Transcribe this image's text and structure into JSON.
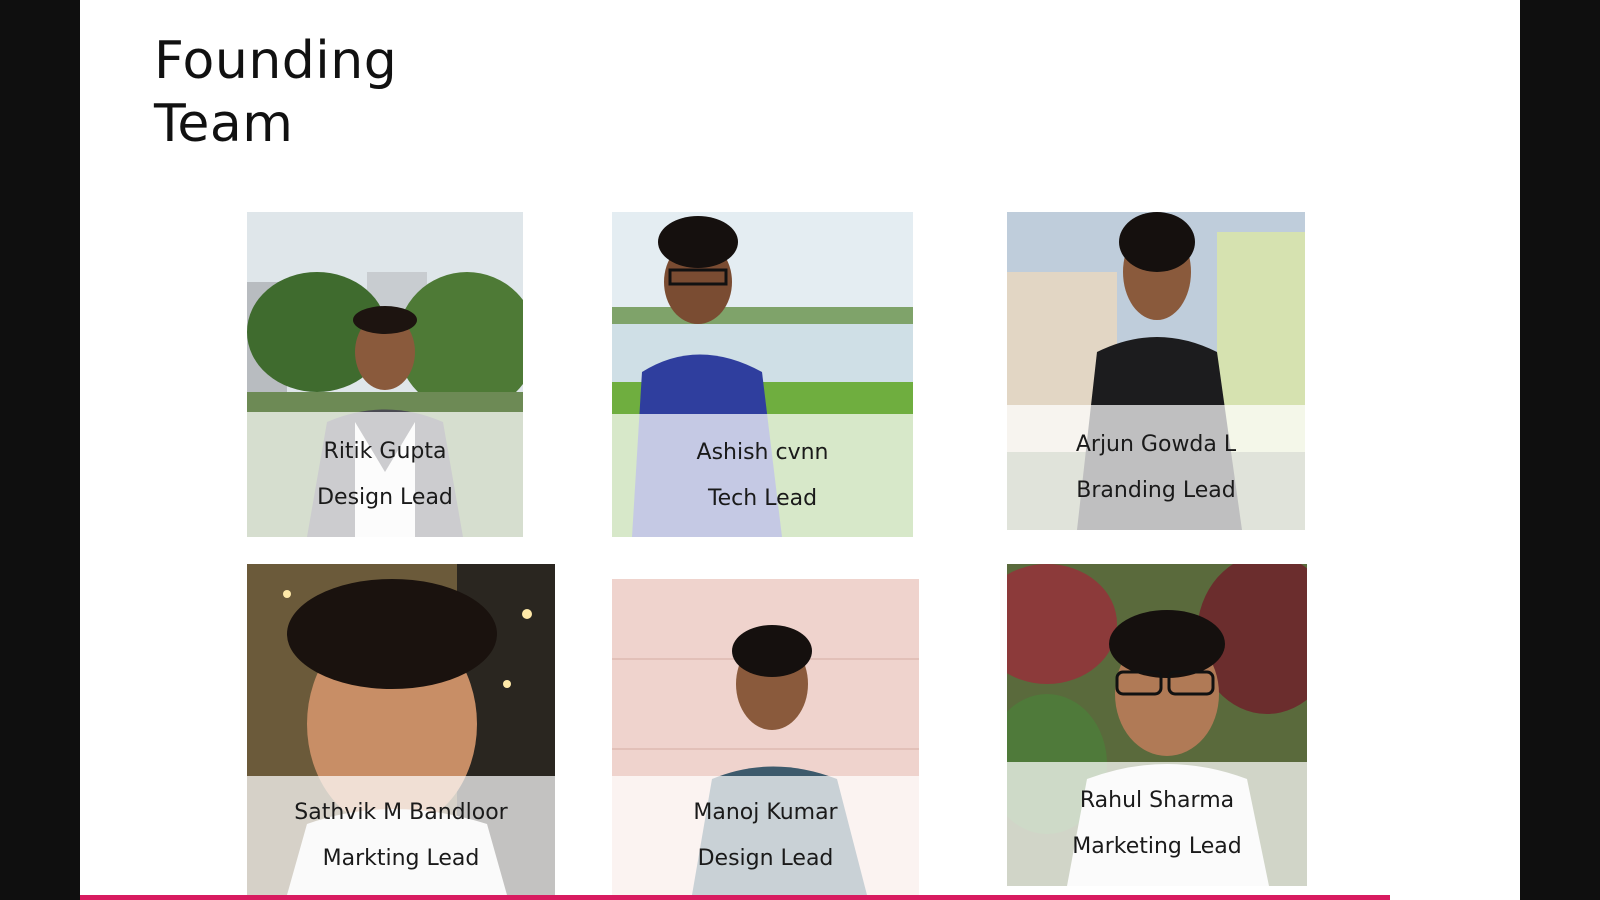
{
  "section": {
    "title_line1": "Founding",
    "title_line2": "Team"
  },
  "accent_color": "#d81b60",
  "team": [
    {
      "name": "Ritik Gupta",
      "role": "Design Lead"
    },
    {
      "name": "Ashish cvnn",
      "role": "Tech Lead"
    },
    {
      "name": "Arjun Gowda L",
      "role": "Branding Lead"
    },
    {
      "name": "Sathvik M Bandloor",
      "role": "Markting Lead"
    },
    {
      "name": "Manoj Kumar",
      "role": "Design Lead"
    },
    {
      "name": "Rahul Sharma",
      "role": "Marketing Lead"
    }
  ]
}
